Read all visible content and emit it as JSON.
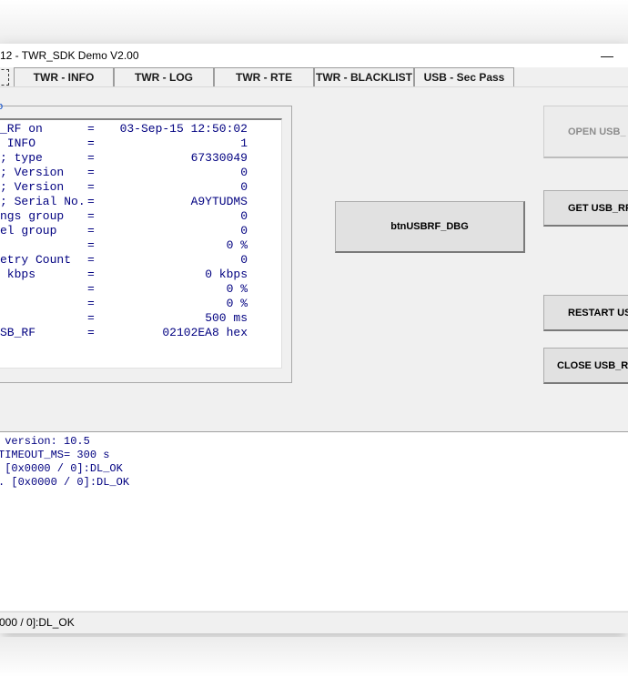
{
  "window": {
    "title": "12  - TWR_SDK Demo V2.00",
    "minimize_glyph": "—"
  },
  "tabs": [
    {
      "label": "TWR - INFO"
    },
    {
      "label": "TWR - LOG"
    },
    {
      "label": "TWR - RTE"
    },
    {
      "label": "TWR - BLACKLIST"
    },
    {
      "label": "USB - Sec Pass"
    }
  ],
  "info": {
    "group_marker": "o",
    "rows": [
      {
        "label": "_RF on",
        "value": "03-Sep-15 12:50:02"
      },
      {
        "label": " INFO",
        "value": "1"
      },
      {
        "label": "; type",
        "value": "67330049"
      },
      {
        "label": "; Version",
        "value": "0"
      },
      {
        "label": "; Version",
        "value": "0"
      },
      {
        "label": "; Serial No.",
        "value": "A9YTUDMS"
      },
      {
        "label": "ngs group",
        "value": "0"
      },
      {
        "label": "el group",
        "value": "0"
      },
      {
        "label": "",
        "value": "0 %"
      },
      {
        "label": "etry Count",
        "value": "0"
      },
      {
        "label": " kbps",
        "value": "0 kbps"
      },
      {
        "label": "",
        "value": "0 %"
      },
      {
        "label": "",
        "value": "0 %"
      },
      {
        "label": "",
        "value": "500 ms"
      },
      {
        "label": "SB_RF",
        "value": "02102EA8 hex"
      }
    ],
    "eq": "="
  },
  "buttons": {
    "open": "OPEN USB_",
    "dbg": "btnUSBRF_DBG",
    "get": "GET USB_RF",
    "restart": "RESTART US",
    "close": "CLOSE USB_RF"
  },
  "log": {
    "lines": [
      " version: 10.5",
      "TIMEOUT_MS= 300 s",
      " [0x0000 / 0]:DL_OK",
      ". [0x0000 / 0]:DL_OK"
    ]
  },
  "status": {
    "text": "000 / 0]:DL_OK"
  }
}
